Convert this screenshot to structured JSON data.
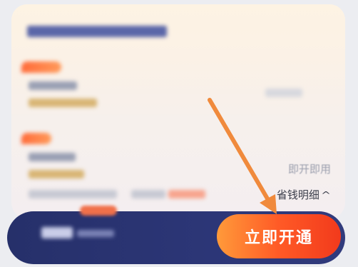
{
  "card": {
    "right_status": "即开即用",
    "savings_link": "省钱明细",
    "savings_chevron": "chevron-up-icon"
  },
  "bottom_bar": {
    "open_button_label": "立即开通"
  },
  "annotation": {
    "arrow_color": "#f08a3c",
    "arrow_icon": "arrow-icon"
  },
  "colors": {
    "button_start": "#ff9a3a",
    "button_end": "#f23a1c",
    "bar_bg": "#26306a"
  }
}
